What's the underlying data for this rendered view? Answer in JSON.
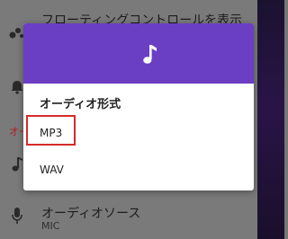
{
  "background_settings": {
    "top_row_label": "フローティングコントロールを表示",
    "red_section_label": "オー",
    "audio_source_label": "オーディオソース",
    "audio_source_value": "MIC"
  },
  "dialog": {
    "header_icon": "music-note-icon",
    "title": "オーディオ形式",
    "options": [
      {
        "label": "MP3",
        "highlighted": true
      },
      {
        "label": "WAV",
        "highlighted": false
      }
    ]
  },
  "colors": {
    "header": "#6a3fc4",
    "highlight_border": "#d62a2a",
    "section_red": "#b32020"
  }
}
